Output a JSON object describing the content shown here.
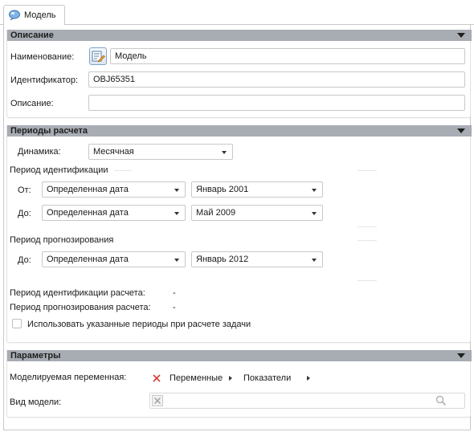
{
  "tab": {
    "label": "Модель",
    "icon": "model-icon"
  },
  "sections": {
    "description": {
      "title": "Описание",
      "name_label": "Наименование:",
      "name_value": "Модель",
      "id_label": "Идентификатор:",
      "id_value": "OBJ65351",
      "desc_label": "Описание:",
      "desc_value": ""
    },
    "periods": {
      "title": "Периоды расчета",
      "dynamics_label": "Динамика:",
      "dynamics_value": "Месячная",
      "ident_title": "Период идентификации",
      "from_label": "От:",
      "from_type": "Определенная дата",
      "from_date": "Январь 2001",
      "to_label": "До:",
      "to_type": "Определенная дата",
      "to_date": "Май 2009",
      "forecast_title": "Период прогнозирования",
      "fc_to_label": "До:",
      "fc_to_type": "Определенная дата",
      "fc_to_date": "Январь 2012",
      "calc_ident_label": "Период идентификации расчета:",
      "calc_ident_value": "-",
      "calc_fc_label": "Период прогнозирования расчета:",
      "calc_fc_value": "-",
      "use_periods_label": "Использовать указанные периоды при расчете задачи",
      "use_periods_checked": false
    },
    "params": {
      "title": "Параметры",
      "var_label": "Моделируемая переменная:",
      "crumb1": "Переменные",
      "crumb2": "Показатели",
      "model_kind_label": "Вид модели:",
      "model_kind_value": ""
    }
  },
  "colors": {
    "header_bg": "#a8acb3",
    "clear_red": "#d43b3b"
  }
}
